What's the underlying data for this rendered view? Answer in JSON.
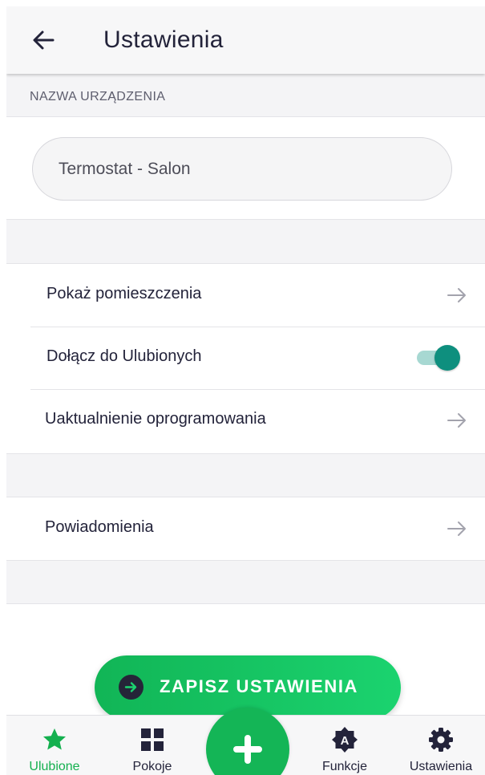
{
  "header": {
    "title": "Ustawienia",
    "back_icon": "arrow-left-icon"
  },
  "device_name": {
    "section_label": "NAZWA URZĄDZENIA",
    "value": "Termostat - Salon",
    "placeholder": ""
  },
  "settings_group_1": [
    {
      "label": "Pokaż pomieszczenia",
      "control": "arrow-right-icon"
    },
    {
      "label": "Dołącz do Ulubionych",
      "control": "toggle",
      "enabled": true
    },
    {
      "label": "Uaktualnienie oprogramowania",
      "control": "arrow-right-icon"
    }
  ],
  "settings_group_2": [
    {
      "label": "Powiadomienia",
      "control": "arrow-right-icon"
    }
  ],
  "save_button": {
    "label": "ZAPISZ USTAWIENIA",
    "icon": "arrow-circle-right-icon"
  },
  "bottom_nav": {
    "active": "Ulubione",
    "items": [
      {
        "label": "Ulubione",
        "icon": "star-icon"
      },
      {
        "label": "Pokoje",
        "icon": "grid-icon"
      },
      {
        "label": "Funkcje",
        "icon": "badge-a-icon"
      },
      {
        "label": "Ustawienia",
        "icon": "gear-icon"
      }
    ],
    "fab_icon": "plus-icon"
  },
  "colors": {
    "accent_green": "#14b556",
    "toggle_teal": "#0e8f7e",
    "text_dark": "#23233a",
    "background_grey": "#f4f4f6"
  }
}
